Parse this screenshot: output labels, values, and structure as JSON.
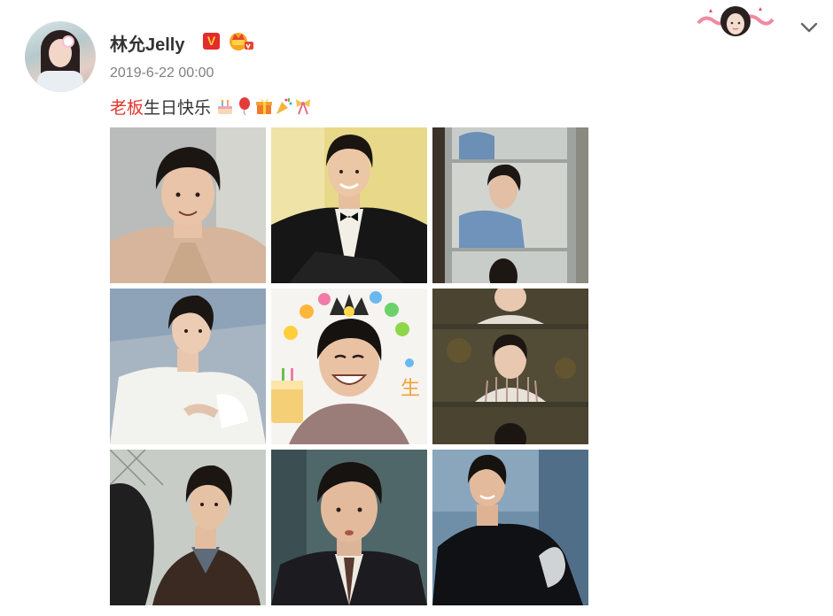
{
  "post": {
    "user_name": "林允Jelly",
    "timestamp": "2019-6-22 00:00",
    "text_highlight": "老板",
    "text_body": "生日快乐",
    "emoji_icons": [
      "birthday-cake-icon",
      "balloon-icon",
      "gift-icon",
      "party-popper-icon",
      "ribbon-icon"
    ],
    "badges": {
      "verified": "V",
      "vip": "crown-vip-icon"
    },
    "menu_icon": "chevron-down-icon",
    "accent_colors": {
      "name": "#333333",
      "highlight": "#e0362f",
      "time": "#808080",
      "verified": "#e32c2c"
    },
    "images": [
      {
        "tile": "portrait-trench-coat"
      },
      {
        "tile": "portrait-tuxedo"
      },
      {
        "tile": "film-strip-denim"
      },
      {
        "tile": "portrait-white-shirt"
      },
      {
        "tile": "portrait-birthday-crown"
      },
      {
        "tile": "film-strip-striped-shirt"
      },
      {
        "tile": "portrait-chainlink-fence"
      },
      {
        "tile": "portrait-school-uniform"
      },
      {
        "tile": "portrait-dark-jacket"
      }
    ]
  }
}
